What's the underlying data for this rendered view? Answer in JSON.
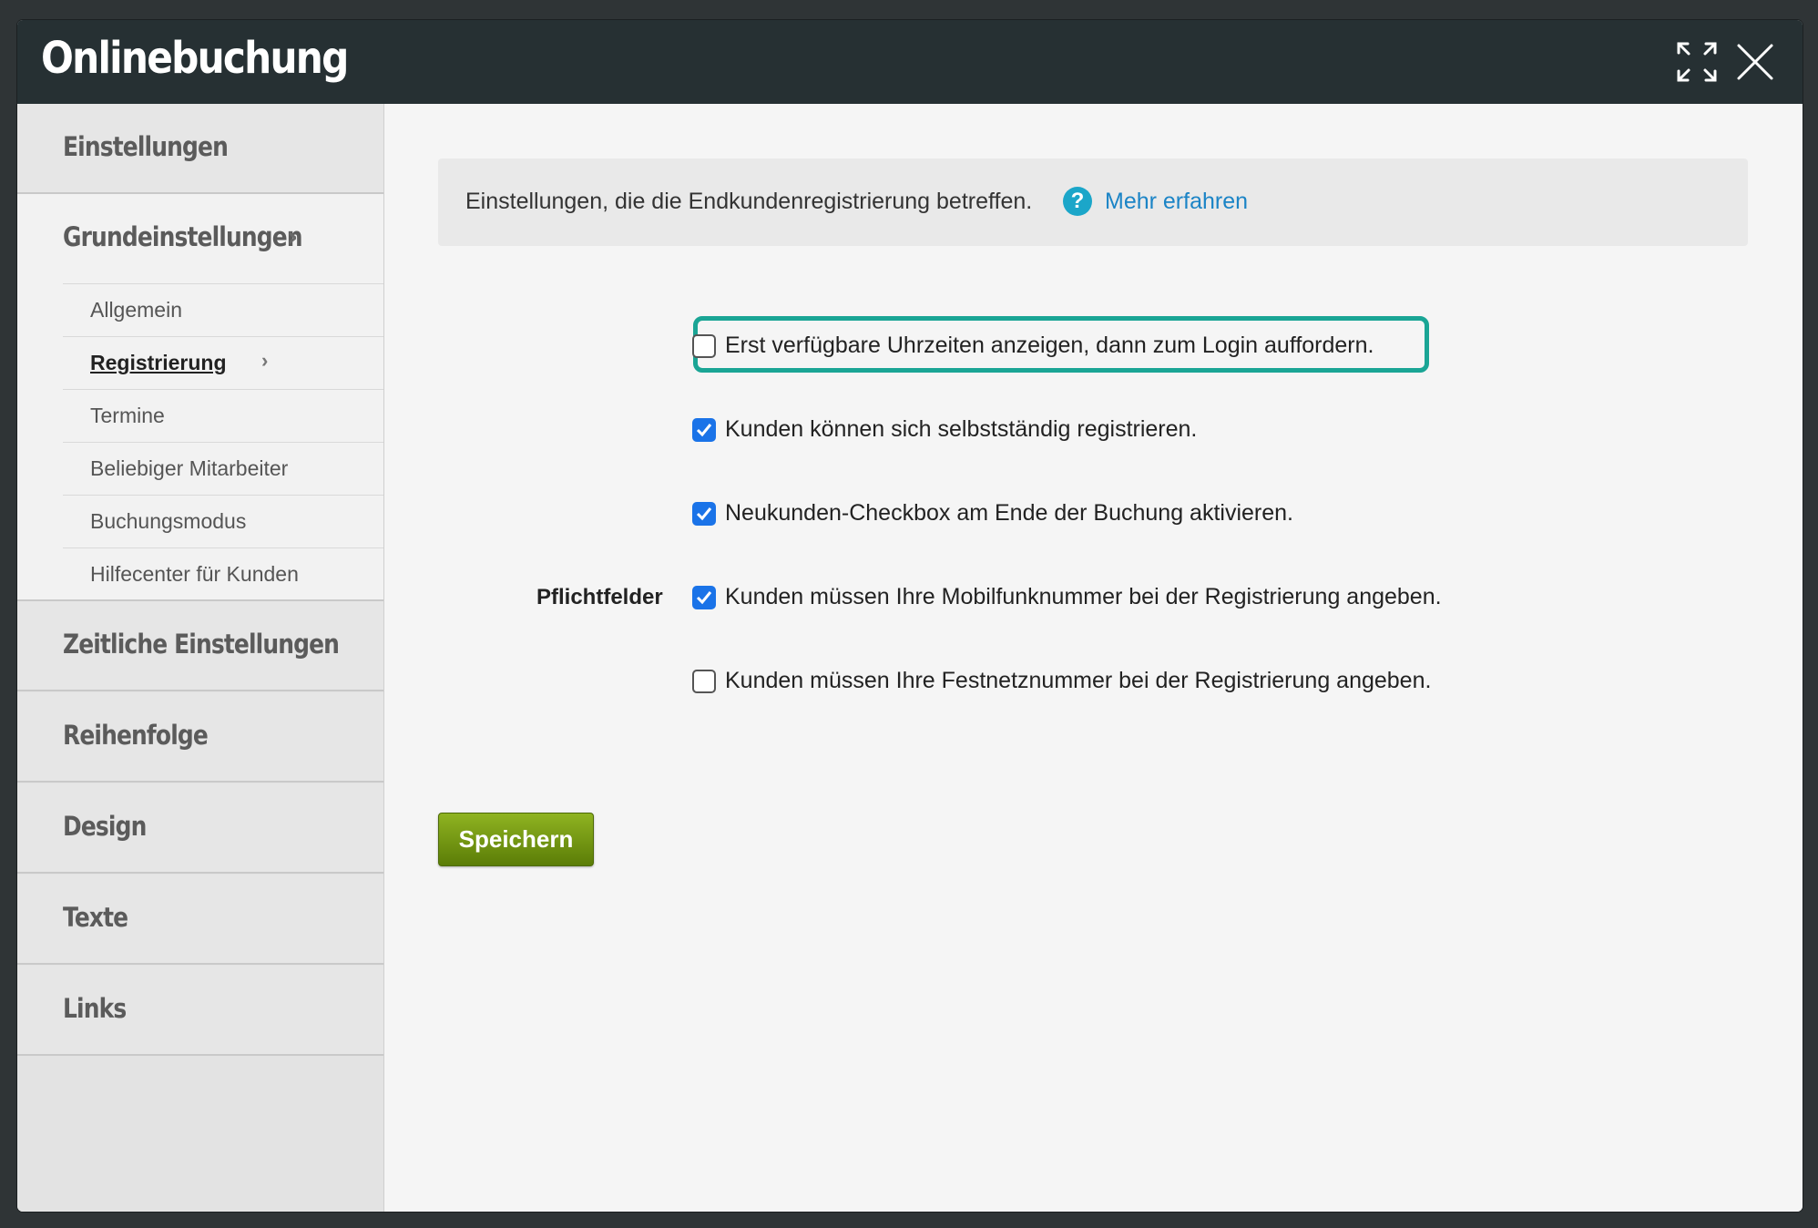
{
  "window": {
    "title": "Onlinebuchung",
    "expand_icon": "expand-icon",
    "close_icon": "close-icon"
  },
  "sidebar": {
    "sections": [
      {
        "label": "Einstellungen"
      },
      {
        "label": "Zeitliche Einstellungen"
      },
      {
        "label": "Reihenfolge"
      },
      {
        "label": "Design"
      },
      {
        "label": "Texte"
      },
      {
        "label": "Links"
      }
    ],
    "open_group": {
      "label": "Grundeinstellungen",
      "chevron": "›",
      "items": [
        {
          "label": "Allgemein"
        },
        {
          "label": "Registrierung"
        },
        {
          "label": "Termine"
        },
        {
          "label": "Beliebiger Mitarbeiter"
        },
        {
          "label": "Buchungsmodus"
        },
        {
          "label": "Hilfecenter für Kunden"
        }
      ],
      "active_item": "Registrierung"
    }
  },
  "main": {
    "info": {
      "text": "Einstellungen, die die Endkundenregistrierung betreffen.",
      "help_icon": "?",
      "link": "Mehr erfahren"
    },
    "options": [
      {
        "label": "Erst verfügbare Uhrzeiten anzeigen, dann zum Login auffordern.",
        "checked": false,
        "highlighted": true
      },
      {
        "label": "Kunden können sich selbstständig registrieren.",
        "checked": true
      },
      {
        "label": "Neukunden-Checkbox am Ende der Buchung aktivieren.",
        "checked": true
      },
      {
        "label": "Kunden müssen Ihre Mobilfunknummer bei der Registrierung angeben.",
        "checked": true
      },
      {
        "label": "Kunden müssen Ihre Festnetznummer bei der Registrierung angeben.",
        "checked": false
      }
    ],
    "required_fields_label": "Pflichtfelder",
    "save_label": "Speichern"
  },
  "colors": {
    "titlebar": "#263033",
    "highlight": "#1aa595",
    "checkbox_checked": "#1a73e8",
    "link": "#1b84c6",
    "save_button": "#6f9512"
  }
}
